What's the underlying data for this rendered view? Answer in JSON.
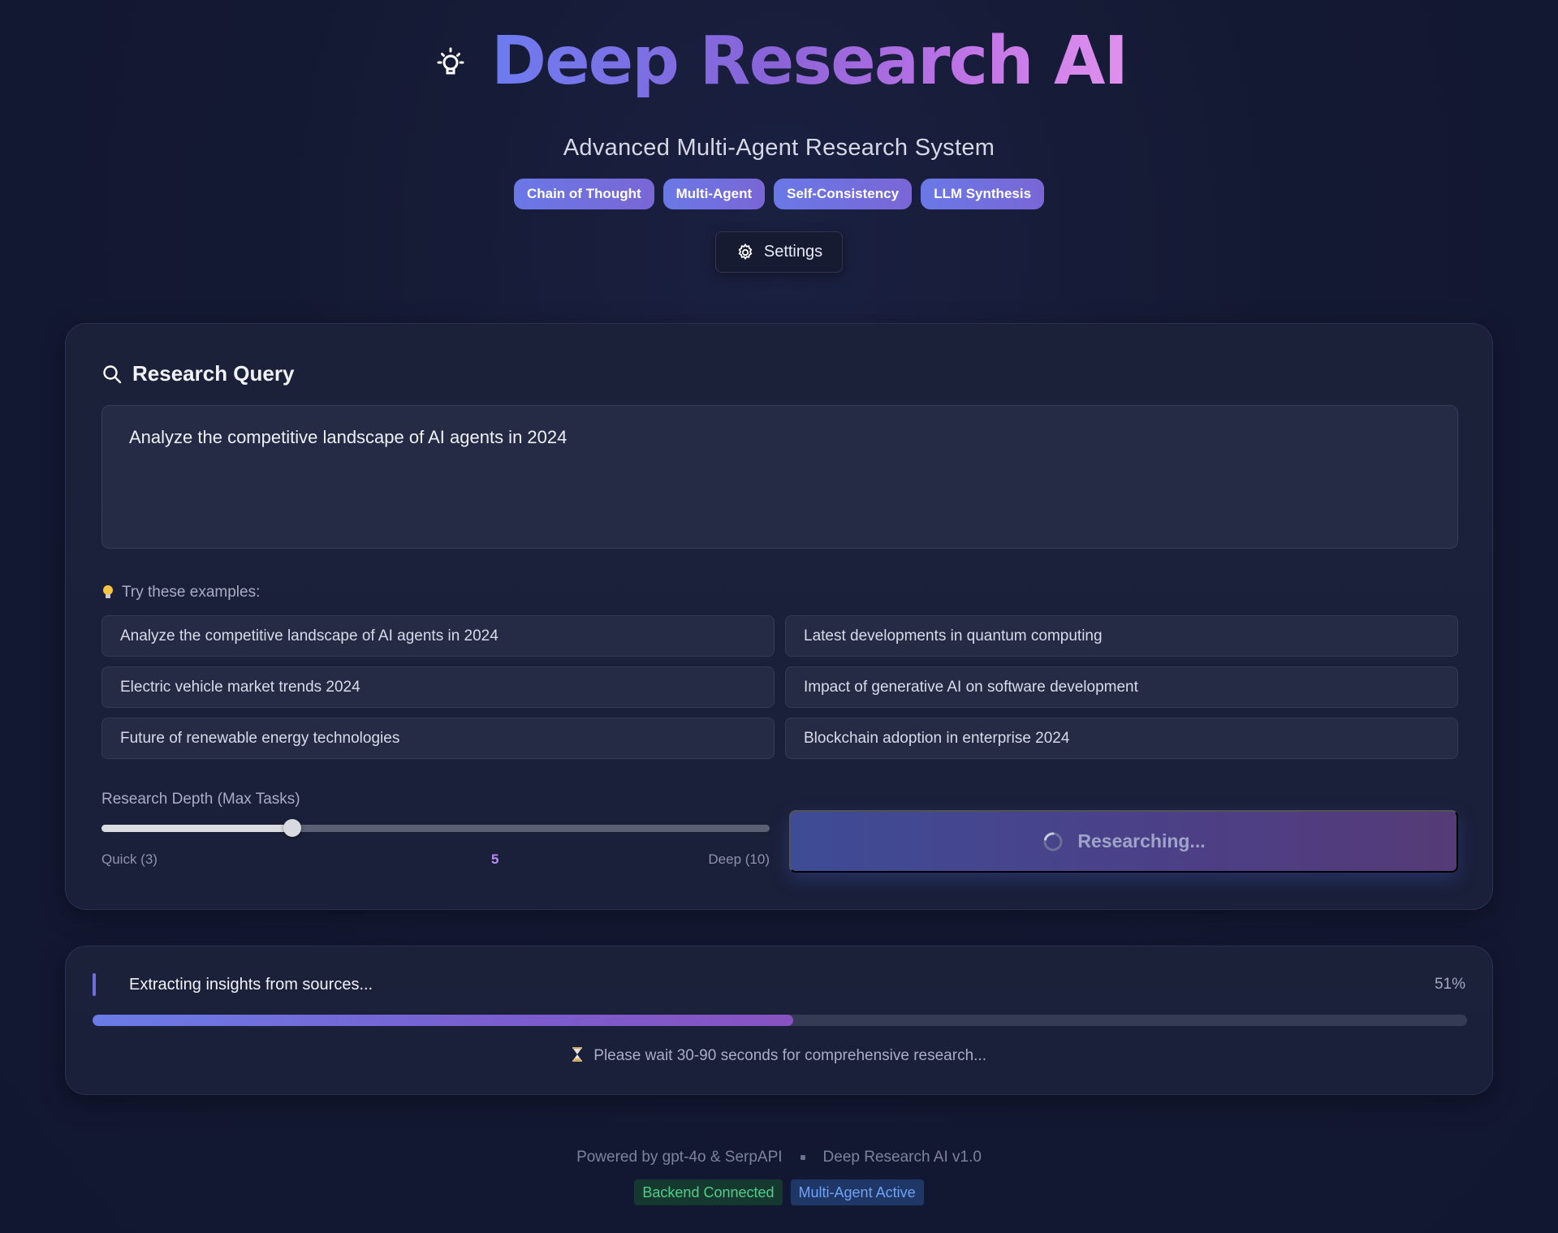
{
  "header": {
    "title": "Deep Research AI",
    "subtitle": "Advanced Multi-Agent Research System",
    "badges": [
      "Chain of Thought",
      "Multi-Agent",
      "Self-Consistency",
      "LLM Synthesis"
    ],
    "settings_label": "Settings",
    "icon": "lightbulb-icon"
  },
  "query": {
    "heading": "Research Query",
    "value": "Analyze the competitive landscape of AI agents in 2024",
    "examples_label": "Try these examples:",
    "examples": [
      "Analyze the competitive landscape of AI agents in 2024",
      "Latest developments in quantum computing",
      "Electric vehicle market trends 2024",
      "Impact of generative AI on software development",
      "Future of renewable energy technologies",
      "Blockchain adoption in enterprise 2024"
    ],
    "depth": {
      "label": "Research Depth (Max Tasks)",
      "min_label": "Quick (3)",
      "max_label": "Deep (10)",
      "min": 3,
      "max": 10,
      "value": 5,
      "value_label": "5"
    },
    "button_label": "Researching..."
  },
  "progress": {
    "status": "Extracting insights from sources...",
    "percent": 51,
    "percent_label": "51%",
    "note": "Please wait 30-90 seconds for comprehensive research..."
  },
  "footer": {
    "powered_by": "Powered by gpt-4o & SerpAPI",
    "version": "Deep Research AI v1.0",
    "status_backend": "Backend Connected",
    "status_agents": "Multi-Agent Active"
  },
  "colors": {
    "background": "#141933",
    "accent_start": "#6d7cf0",
    "accent_end": "#e091ee",
    "success": "#4fd08a",
    "info": "#6ea2f4"
  }
}
